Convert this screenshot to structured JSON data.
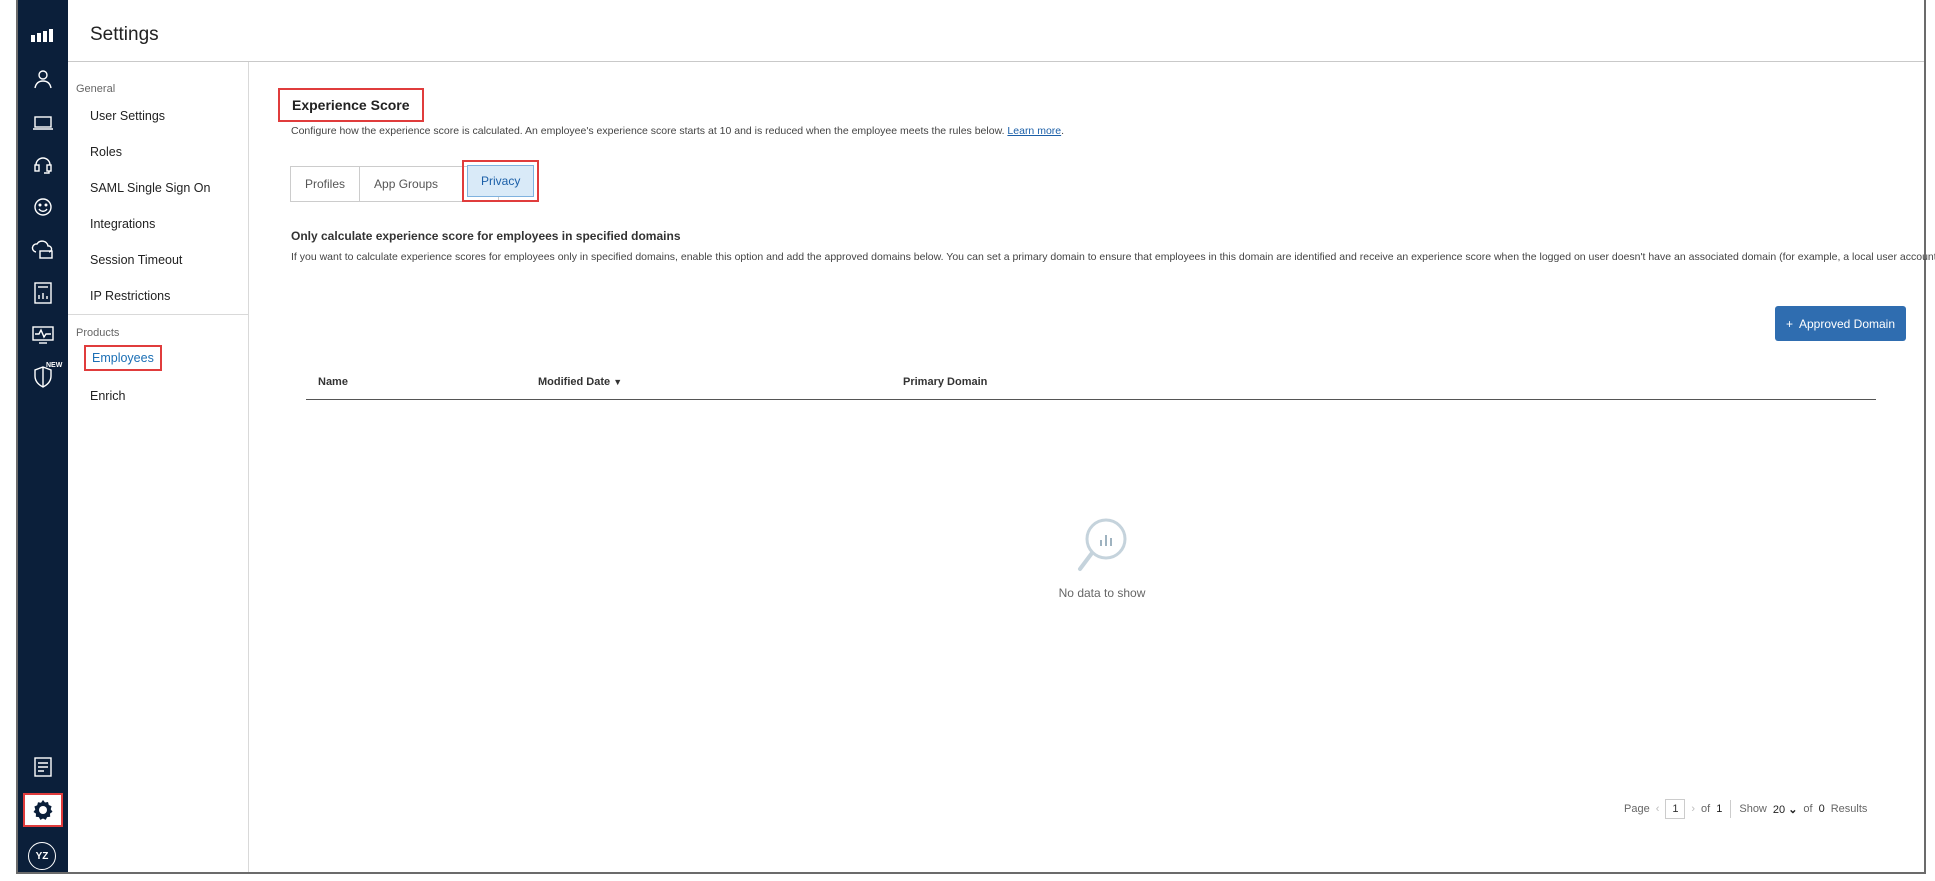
{
  "header": {
    "title": "Settings"
  },
  "sidebar_nav": {
    "general_label": "General",
    "general_items": [
      "User Settings",
      "Roles",
      "SAML Single Sign On",
      "Integrations",
      "Session Timeout",
      "IP Restrictions"
    ],
    "products_label": "Products",
    "products_items": [
      "Employees",
      "Enrich"
    ],
    "active": "Employees"
  },
  "rail": {
    "icons": [
      "logo-icon",
      "person-icon",
      "laptop-icon",
      "headset-icon",
      "smile-icon",
      "cloud-icon",
      "report-icon",
      "monitor-icon",
      "shield-icon",
      "document-icon",
      "gear-icon"
    ],
    "new_badge": "NEW",
    "avatar_initials": "YZ"
  },
  "main": {
    "title": "Experience Score",
    "description": "Configure how the experience score is calculated. An employee's experience score starts at 10 and is reduced when the employee meets the rules below.",
    "learn_more": "Learn more",
    "tabs": [
      "Profiles",
      "App Groups",
      "Privacy"
    ],
    "active_tab": "Privacy",
    "section_title": "Only calculate experience score for employees in specified domains",
    "section_desc": "If you want to calculate experience scores for employees only in specified domains, enable this option and add the approved domains below. You can set a primary domain to ensure that employees in this domain are identified and receive an experience score when the logged on user doesn't have an associated domain (for example, a local user account).",
    "add_button": "Approved Domain",
    "table": {
      "columns": [
        "Name",
        "Modified Date",
        "Primary Domain"
      ],
      "rows": [],
      "empty_text": "No data to show"
    },
    "pagination": {
      "page_label": "Page",
      "page": "1",
      "of_label": "of",
      "total_pages": "1",
      "show_label": "Show",
      "page_size": "20",
      "results_of": "of",
      "results_count": "0",
      "results_label": "Results"
    }
  },
  "colors": {
    "rail": "#0b1f3a",
    "primary": "#2f6db0",
    "highlight": "#e03c3c",
    "link": "#1b5fa8"
  }
}
